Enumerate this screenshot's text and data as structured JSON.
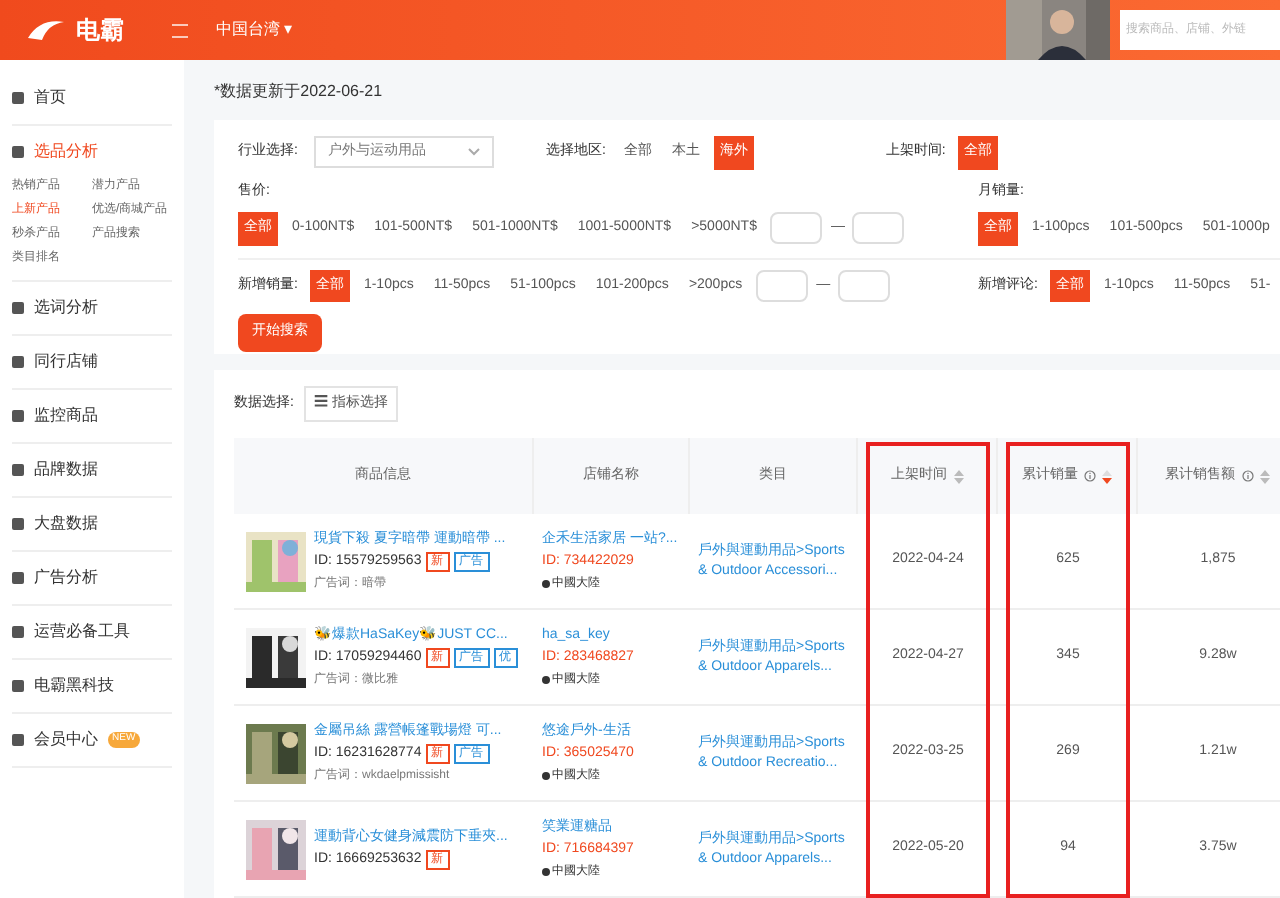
{
  "header": {
    "logo": "电霸",
    "region": "中国台湾 ▾",
    "search": {
      "placeholder": "搜索商品、店铺、外链"
    }
  },
  "sidebar": {
    "items": [
      {
        "label": "首页",
        "selected": false
      },
      {
        "label": "选品分析",
        "selected": true,
        "children": [
          {
            "label": "热销产品",
            "selected": false
          },
          {
            "label": "潜力产品",
            "selected": false
          },
          {
            "label": "上新产品",
            "selected": true
          },
          {
            "label": "优选/商城产品",
            "selected": false
          },
          {
            "label": "秒杀产品",
            "selected": false
          },
          {
            "label": "产品搜索",
            "selected": false
          },
          {
            "label": "类目排名",
            "selected": false
          }
        ]
      },
      {
        "label": "选词分析",
        "selected": false
      },
      {
        "label": "同行店铺",
        "selected": false
      },
      {
        "label": "监控商品",
        "selected": false
      },
      {
        "label": "品牌数据",
        "selected": false
      },
      {
        "label": "大盘数据",
        "selected": false
      },
      {
        "label": "广告分析",
        "selected": false
      },
      {
        "label": "运营必备工具",
        "selected": false
      },
      {
        "label": "电霸黑科技",
        "selected": false
      },
      {
        "label": "会员中心",
        "selected": false,
        "badge": "NEW"
      }
    ]
  },
  "update_note": "*数据更新于2022-06-21",
  "filters": {
    "industry": {
      "label": "行业选择:",
      "value": "户外与运动用品"
    },
    "region": {
      "label": "选择地区:",
      "options": [
        {
          "label": "全部",
          "selected": false
        },
        {
          "label": "本土",
          "selected": false
        },
        {
          "label": "海外",
          "selected": true
        }
      ]
    },
    "listing_time": {
      "label": "上架时间:",
      "options": [
        {
          "label": "全部",
          "selected": true
        }
      ]
    },
    "price": {
      "label": "售价:",
      "options": [
        {
          "label": "全部",
          "selected": true
        },
        {
          "label": "0-100NT$",
          "selected": false
        },
        {
          "label": "101-500NT$",
          "selected": false
        },
        {
          "label": "501-1000NT$",
          "selected": false
        },
        {
          "label": "1001-5000NT$",
          "selected": false
        },
        {
          "label": ">5000NT$",
          "selected": false
        }
      ],
      "separator": "—"
    },
    "monthly_sales": {
      "label": "月销量:",
      "options": [
        {
          "label": "全部",
          "selected": true
        },
        {
          "label": "1-100pcs",
          "selected": false
        },
        {
          "label": "101-500pcs",
          "selected": false
        },
        {
          "label": "501-1000p",
          "selected": false
        }
      ]
    },
    "new_sales": {
      "label": "新增销量:",
      "options": [
        {
          "label": "全部",
          "selected": true
        },
        {
          "label": "1-10pcs",
          "selected": false
        },
        {
          "label": "11-50pcs",
          "selected": false
        },
        {
          "label": "51-100pcs",
          "selected": false
        },
        {
          "label": "101-200pcs",
          "selected": false
        },
        {
          "label": ">200pcs",
          "selected": false
        }
      ],
      "separator": "—"
    },
    "new_reviews": {
      "label": "新增评论:",
      "options": [
        {
          "label": "全部",
          "selected": true
        },
        {
          "label": "1-10pcs",
          "selected": false
        },
        {
          "label": "11-50pcs",
          "selected": false
        },
        {
          "label": "51-",
          "selected": false
        }
      ]
    },
    "search_button": "开始搜索"
  },
  "data_select": {
    "label": "数据选择:",
    "button": "☰ 指标选择"
  },
  "table": {
    "columns": [
      {
        "label": "商品信息",
        "sortable": false,
        "sorted_desc": false,
        "info": false,
        "highlighted": false
      },
      {
        "label": "店铺名称",
        "sortable": false,
        "sorted_desc": false,
        "info": false,
        "highlighted": false
      },
      {
        "label": "类目",
        "sortable": false,
        "sorted_desc": false,
        "info": false,
        "highlighted": false
      },
      {
        "label": "上架时间",
        "sortable": true,
        "sorted_desc": false,
        "info": false,
        "highlighted": true
      },
      {
        "label": "累计销量",
        "sortable": true,
        "sorted_desc": true,
        "info": true,
        "highlighted": true
      },
      {
        "label": "累计销售额",
        "sortable": true,
        "sorted_desc": false,
        "info": true,
        "highlighted": false
      }
    ],
    "rows": [
      {
        "title": "現貨下殺 夏字暗帶 運動暗帶 ...",
        "id": "ID: 15579259563",
        "tags": [
          {
            "kind": "new",
            "label": "新"
          },
          {
            "kind": "ad",
            "label": "广告"
          }
        ],
        "ad_keyword": "广告词：暗帶",
        "shop": "企禾生活家居 一站?...",
        "shop_id": "ID: 734422029",
        "location": "中國大陸",
        "category": "戶外與運動用品>Sports & Outdoor Accessori...",
        "date": "2022-04-24",
        "sales": "625",
        "revenue": "1,875"
      },
      {
        "title": "🐝爆款HaSaKey🐝JUST CC...",
        "id": "ID: 17059294460",
        "tags": [
          {
            "kind": "new",
            "label": "新"
          },
          {
            "kind": "ad",
            "label": "广告"
          },
          {
            "kind": "ad",
            "label": "优"
          }
        ],
        "ad_keyword": "广告词：微比雅",
        "shop": "ha_sa_key",
        "shop_id": "ID: 283468827",
        "location": "中國大陸",
        "category": "戶外與運動用品>Sports & Outdoor Apparels...",
        "date": "2022-04-27",
        "sales": "345",
        "revenue": "9.28w"
      },
      {
        "title": "金屬吊絲 露營帳篷戰場燈 可...",
        "id": "ID: 16231628774",
        "tags": [
          {
            "kind": "new",
            "label": "新"
          },
          {
            "kind": "ad",
            "label": "广告"
          }
        ],
        "ad_keyword": "广告词：wkdaelpmissisht",
        "shop": "悠途戶外-生活",
        "shop_id": "ID: 365025470",
        "location": "中國大陸",
        "category": "戶外與運動用品>Sports & Outdoor Recreatio...",
        "date": "2022-03-25",
        "sales": "269",
        "revenue": "1.21w"
      },
      {
        "title": "運動背心女健身減震防下垂夾...",
        "id": "ID: 16669253632",
        "tags": [
          {
            "kind": "new",
            "label": "新"
          }
        ],
        "shop": "笑業運糖品",
        "shop_id": "ID: 716684397",
        "location": "中國大陸",
        "category": "戶外與運動用品>Sports & Outdoor Apparels...",
        "date": "2022-05-20",
        "sales": "94",
        "revenue": "3.75w"
      }
    ]
  }
}
